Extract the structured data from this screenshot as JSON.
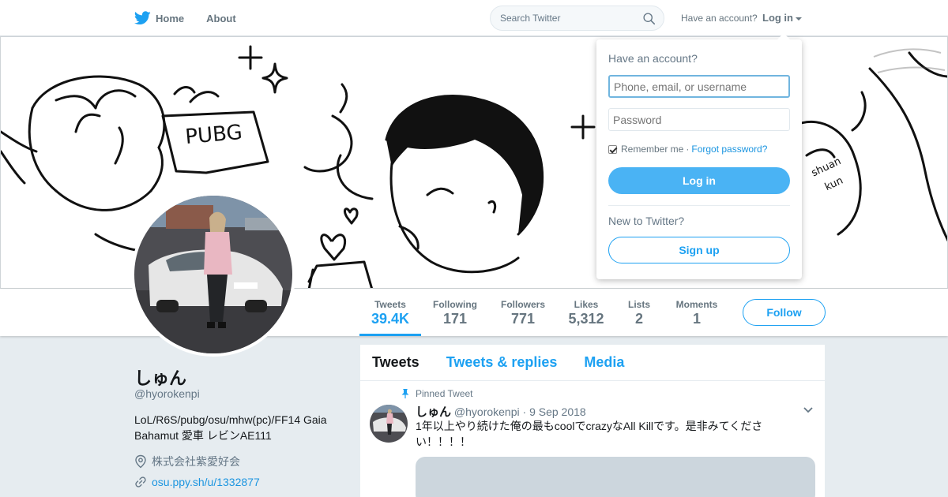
{
  "topbar": {
    "home_label": "Home",
    "about_label": "About",
    "search_placeholder": "Search Twitter",
    "have_account": "Have an account?",
    "login_label": "Log in"
  },
  "login_dropdown": {
    "title": "Have an account?",
    "username_placeholder": "Phone, email, or username",
    "password_placeholder": "Password",
    "remember_me": "Remember me",
    "separator": "·",
    "forgot_password": "Forgot password?",
    "login_button": "Log in",
    "new_to_twitter": "New to Twitter?",
    "signup_button": "Sign up",
    "remember_checked": true
  },
  "banner": {
    "drawing_text_pubg": "PUBG",
    "drawing_text_shuan": "shuan",
    "drawing_text_kun": "kun"
  },
  "profile_nav": {
    "stats": [
      {
        "label": "Tweets",
        "value": "39.4K"
      },
      {
        "label": "Following",
        "value": "171"
      },
      {
        "label": "Followers",
        "value": "771"
      },
      {
        "label": "Likes",
        "value": "5,312"
      },
      {
        "label": "Lists",
        "value": "2"
      },
      {
        "label": "Moments",
        "value": "1"
      }
    ],
    "follow_button": "Follow"
  },
  "profile": {
    "name": "しゅん",
    "handle": "@hyorokenpi",
    "bio": "LoL/R6S/pubg/osu/mhw(pc)/FF14 Gaia Bahamut 愛車 レビンAE111",
    "location": "株式会社紫愛好会",
    "url": "osu.ppy.sh/u/1332877"
  },
  "timeline": {
    "tabs": [
      "Tweets",
      "Tweets & replies",
      "Media"
    ],
    "pinned_label": "Pinned Tweet",
    "tweet": {
      "name": "しゅん",
      "handle": "@hyorokenpi",
      "separator": "·",
      "date": "9 Sep 2018",
      "text": "1年以上やり続けた俺の最もcoolでcrazyなAll Killです。是非みてください！！！！"
    }
  },
  "colors": {
    "accent": "#1da1f2",
    "login_button": "#4ab3f4",
    "page_bg": "#e6ecf0"
  }
}
